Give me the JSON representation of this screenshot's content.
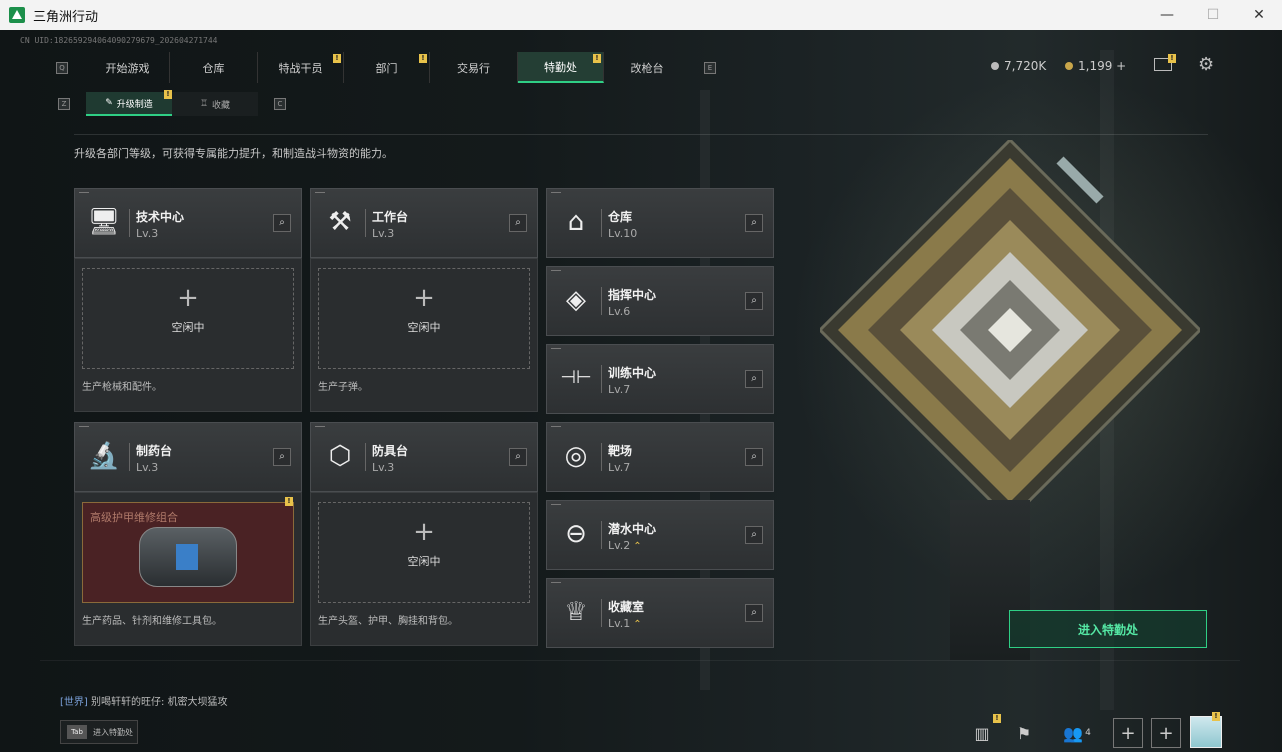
{
  "window": {
    "title": "三角洲行动",
    "minimize": "—",
    "maximize": "☐",
    "close": "✕"
  },
  "uid": "CN UID:182659294064090279679_202604271744",
  "nav": {
    "left_key": "Q",
    "right_key": "E",
    "tabs": [
      {
        "label": "开始游戏",
        "badge": ""
      },
      {
        "label": "仓库",
        "badge": ""
      },
      {
        "label": "特战干员",
        "badge": "!"
      },
      {
        "label": "部门",
        "badge": "!"
      },
      {
        "label": "交易行",
        "badge": ""
      },
      {
        "label": "特勤处",
        "badge": "!"
      },
      {
        "label": "改枪台",
        "badge": ""
      }
    ],
    "active": "特勤处"
  },
  "subnav": {
    "left_key": "Z",
    "right_key": "C",
    "tabs": [
      {
        "label": "升级制造",
        "badge": "!"
      },
      {
        "label": "收藏",
        "badge": ""
      }
    ]
  },
  "currency": {
    "silver": "7,720K",
    "gold": "1,199 +"
  },
  "description": "升级各部门等级，可获得专属能力提升，和制造战斗物资的能力。",
  "stations": [
    {
      "name": "技术中心",
      "level": "Lv.3",
      "icon": "monitor-icon",
      "symbol": "🖥"
    },
    {
      "name": "工作台",
      "level": "Lv.3",
      "icon": "tools-icon",
      "symbol": "⚒"
    },
    {
      "name": "制药台",
      "level": "Lv.3",
      "icon": "microscope-icon",
      "symbol": "🔬"
    },
    {
      "name": "防具台",
      "level": "Lv.3",
      "icon": "cubes-icon",
      "symbol": "⬡"
    }
  ],
  "slots": [
    {
      "status": "空闲中",
      "plus": "+",
      "caption": "生产枪械和配件。"
    },
    {
      "status": "空闲中",
      "plus": "+",
      "caption": "生产子弹。"
    },
    {
      "status": "",
      "plus": "",
      "caption": "生产药品、针剂和维修工具包。",
      "product": "高级护甲维修组合",
      "badge": "!"
    },
    {
      "status": "空闲中",
      "plus": "+",
      "caption": "生产头盔、护甲、胸挂和背包。"
    }
  ],
  "departments": [
    {
      "name": "仓库",
      "level": "Lv.10",
      "up": "",
      "icon": "vault-icon",
      "symbol": "⌂"
    },
    {
      "name": "指挥中心",
      "level": "Lv.6",
      "up": "",
      "icon": "chip-icon",
      "symbol": "◈"
    },
    {
      "name": "训练中心",
      "level": "Lv.7",
      "up": "",
      "icon": "dumbbell-icon",
      "symbol": "⊣⊢"
    },
    {
      "name": "靶场",
      "level": "Lv.7",
      "up": "",
      "icon": "target-icon",
      "symbol": "◎"
    },
    {
      "name": "潜水中心",
      "level": "Lv.2",
      "up": "⌃",
      "icon": "diving-mask-icon",
      "symbol": "⊖"
    },
    {
      "name": "收藏室",
      "level": "Lv.1",
      "up": "⌃",
      "icon": "trophy-icon",
      "symbol": "♕"
    }
  ],
  "search_symbol": "⌕",
  "enter_button": "进入特勤处",
  "chat": {
    "channel": "[世界]",
    "sender": "别喝轩轩的旺仔:",
    "message": "机密大坝猛攻"
  },
  "tab_hint": {
    "key": "Tab",
    "label": "进入特勤处"
  },
  "bottom": {
    "friends_count": "4",
    "plus": "+"
  },
  "colors": {
    "accent": "#2fcf85",
    "badge": "#e8c24a"
  }
}
